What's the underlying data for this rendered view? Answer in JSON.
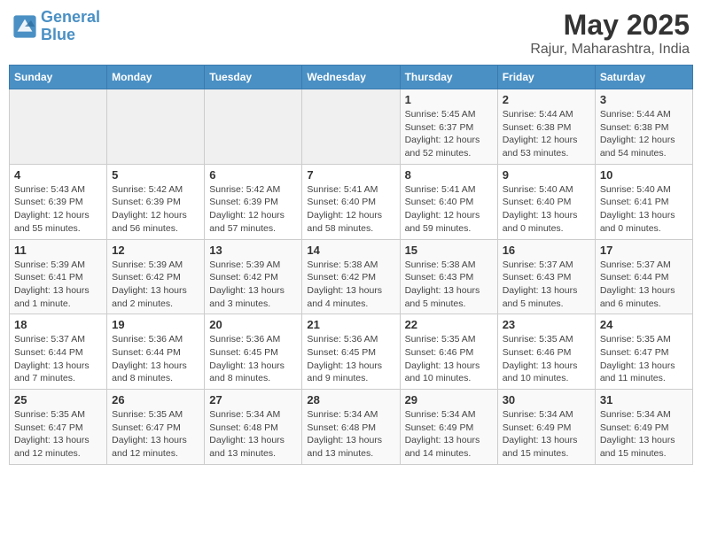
{
  "header": {
    "logo_line1": "General",
    "logo_line2": "Blue",
    "title": "May 2025",
    "subtitle": "Rajur, Maharashtra, India"
  },
  "days_of_week": [
    "Sunday",
    "Monday",
    "Tuesday",
    "Wednesday",
    "Thursday",
    "Friday",
    "Saturday"
  ],
  "weeks": [
    [
      {
        "day": "",
        "info": ""
      },
      {
        "day": "",
        "info": ""
      },
      {
        "day": "",
        "info": ""
      },
      {
        "day": "",
        "info": ""
      },
      {
        "day": "1",
        "info": "Sunrise: 5:45 AM\nSunset: 6:37 PM\nDaylight: 12 hours\nand 52 minutes."
      },
      {
        "day": "2",
        "info": "Sunrise: 5:44 AM\nSunset: 6:38 PM\nDaylight: 12 hours\nand 53 minutes."
      },
      {
        "day": "3",
        "info": "Sunrise: 5:44 AM\nSunset: 6:38 PM\nDaylight: 12 hours\nand 54 minutes."
      }
    ],
    [
      {
        "day": "4",
        "info": "Sunrise: 5:43 AM\nSunset: 6:39 PM\nDaylight: 12 hours\nand 55 minutes."
      },
      {
        "day": "5",
        "info": "Sunrise: 5:42 AM\nSunset: 6:39 PM\nDaylight: 12 hours\nand 56 minutes."
      },
      {
        "day": "6",
        "info": "Sunrise: 5:42 AM\nSunset: 6:39 PM\nDaylight: 12 hours\nand 57 minutes."
      },
      {
        "day": "7",
        "info": "Sunrise: 5:41 AM\nSunset: 6:40 PM\nDaylight: 12 hours\nand 58 minutes."
      },
      {
        "day": "8",
        "info": "Sunrise: 5:41 AM\nSunset: 6:40 PM\nDaylight: 12 hours\nand 59 minutes."
      },
      {
        "day": "9",
        "info": "Sunrise: 5:40 AM\nSunset: 6:40 PM\nDaylight: 13 hours\nand 0 minutes."
      },
      {
        "day": "10",
        "info": "Sunrise: 5:40 AM\nSunset: 6:41 PM\nDaylight: 13 hours\nand 0 minutes."
      }
    ],
    [
      {
        "day": "11",
        "info": "Sunrise: 5:39 AM\nSunset: 6:41 PM\nDaylight: 13 hours\nand 1 minute."
      },
      {
        "day": "12",
        "info": "Sunrise: 5:39 AM\nSunset: 6:42 PM\nDaylight: 13 hours\nand 2 minutes."
      },
      {
        "day": "13",
        "info": "Sunrise: 5:39 AM\nSunset: 6:42 PM\nDaylight: 13 hours\nand 3 minutes."
      },
      {
        "day": "14",
        "info": "Sunrise: 5:38 AM\nSunset: 6:42 PM\nDaylight: 13 hours\nand 4 minutes."
      },
      {
        "day": "15",
        "info": "Sunrise: 5:38 AM\nSunset: 6:43 PM\nDaylight: 13 hours\nand 5 minutes."
      },
      {
        "day": "16",
        "info": "Sunrise: 5:37 AM\nSunset: 6:43 PM\nDaylight: 13 hours\nand 5 minutes."
      },
      {
        "day": "17",
        "info": "Sunrise: 5:37 AM\nSunset: 6:44 PM\nDaylight: 13 hours\nand 6 minutes."
      }
    ],
    [
      {
        "day": "18",
        "info": "Sunrise: 5:37 AM\nSunset: 6:44 PM\nDaylight: 13 hours\nand 7 minutes."
      },
      {
        "day": "19",
        "info": "Sunrise: 5:36 AM\nSunset: 6:44 PM\nDaylight: 13 hours\nand 8 minutes."
      },
      {
        "day": "20",
        "info": "Sunrise: 5:36 AM\nSunset: 6:45 PM\nDaylight: 13 hours\nand 8 minutes."
      },
      {
        "day": "21",
        "info": "Sunrise: 5:36 AM\nSunset: 6:45 PM\nDaylight: 13 hours\nand 9 minutes."
      },
      {
        "day": "22",
        "info": "Sunrise: 5:35 AM\nSunset: 6:46 PM\nDaylight: 13 hours\nand 10 minutes."
      },
      {
        "day": "23",
        "info": "Sunrise: 5:35 AM\nSunset: 6:46 PM\nDaylight: 13 hours\nand 10 minutes."
      },
      {
        "day": "24",
        "info": "Sunrise: 5:35 AM\nSunset: 6:47 PM\nDaylight: 13 hours\nand 11 minutes."
      }
    ],
    [
      {
        "day": "25",
        "info": "Sunrise: 5:35 AM\nSunset: 6:47 PM\nDaylight: 13 hours\nand 12 minutes."
      },
      {
        "day": "26",
        "info": "Sunrise: 5:35 AM\nSunset: 6:47 PM\nDaylight: 13 hours\nand 12 minutes."
      },
      {
        "day": "27",
        "info": "Sunrise: 5:34 AM\nSunset: 6:48 PM\nDaylight: 13 hours\nand 13 minutes."
      },
      {
        "day": "28",
        "info": "Sunrise: 5:34 AM\nSunset: 6:48 PM\nDaylight: 13 hours\nand 13 minutes."
      },
      {
        "day": "29",
        "info": "Sunrise: 5:34 AM\nSunset: 6:49 PM\nDaylight: 13 hours\nand 14 minutes."
      },
      {
        "day": "30",
        "info": "Sunrise: 5:34 AM\nSunset: 6:49 PM\nDaylight: 13 hours\nand 15 minutes."
      },
      {
        "day": "31",
        "info": "Sunrise: 5:34 AM\nSunset: 6:49 PM\nDaylight: 13 hours\nand 15 minutes."
      }
    ]
  ]
}
